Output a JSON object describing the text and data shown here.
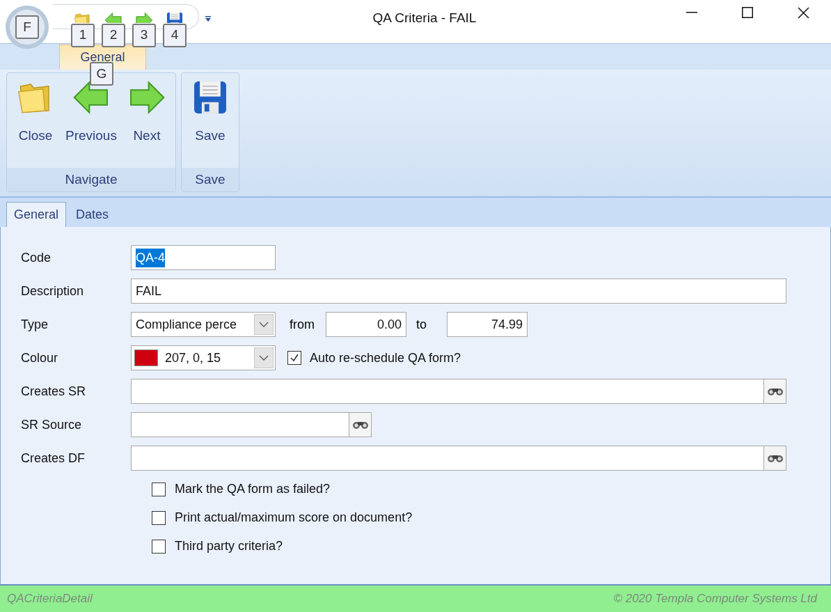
{
  "window": {
    "title": "QA Criteria - FAIL"
  },
  "app_button": {
    "key_tip": "F"
  },
  "quick_access": [
    {
      "kind": "folder",
      "key_tip": "1"
    },
    {
      "kind": "back",
      "key_tip": "2"
    },
    {
      "kind": "forward",
      "key_tip": "3"
    },
    {
      "kind": "save",
      "key_tip": "4"
    }
  ],
  "ribbon_tabs": [
    {
      "label": "General",
      "selected": true,
      "key_tip": "G"
    }
  ],
  "ribbon_groups": [
    {
      "label": "Navigate",
      "buttons": [
        {
          "label": "Close",
          "kind": "folder"
        },
        {
          "label": "Previous",
          "kind": "back"
        },
        {
          "label": "Next",
          "kind": "forward"
        }
      ]
    },
    {
      "label": "Save",
      "buttons": [
        {
          "label": "Save",
          "kind": "save"
        }
      ]
    }
  ],
  "form_tabs": [
    {
      "label": "General",
      "selected": true
    },
    {
      "label": "Dates",
      "selected": false
    }
  ],
  "fields": [
    {
      "kind": "short_text",
      "label": "Code",
      "value": "QA-4",
      "text_selected": true
    },
    {
      "kind": "text",
      "label": "Description",
      "value": "FAIL"
    },
    {
      "kind": "range",
      "label": "Type",
      "value": "Compliance perce",
      "from_label": "from",
      "from": "0.00",
      "to_label": "to",
      "to": "74.99"
    },
    {
      "kind": "colour",
      "label": "Colour",
      "value": "207, 0, 15",
      "color": "#cf000f",
      "option": {
        "label": "Auto re-schedule QA form?",
        "checked": true
      }
    },
    {
      "kind": "lookup",
      "label": "Creates SR"
    },
    {
      "kind": "short_lookup",
      "label": "SR Source"
    },
    {
      "kind": "lookup",
      "label": "Creates DF"
    }
  ],
  "checkboxes": [
    {
      "label": "Mark the QA form as failed?",
      "checked": false
    },
    {
      "label": "Print actual/maximum score on document?",
      "checked": false
    },
    {
      "label": "Third party criteria?",
      "checked": false
    }
  ],
  "status_bar": {
    "left": "QACriteriaDetail",
    "right": "© 2020 Templa Computer Systems Ltd"
  }
}
